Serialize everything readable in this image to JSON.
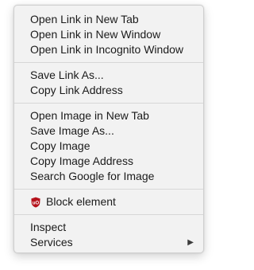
{
  "menu": {
    "group1": [
      {
        "label": "Open Link in New Tab"
      },
      {
        "label": "Open Link in New Window"
      },
      {
        "label": "Open Link in Incognito Window"
      }
    ],
    "group2": [
      {
        "label": "Save Link As..."
      },
      {
        "label": "Copy Link Address"
      }
    ],
    "group3": [
      {
        "label": "Open Image in New Tab"
      },
      {
        "label": "Save Image As..."
      },
      {
        "label": "Copy Image"
      },
      {
        "label": "Copy Image Address"
      },
      {
        "label": "Search Google for Image"
      }
    ],
    "group4": [
      {
        "label": "Block element",
        "icon": "ublock-origin-shield-icon"
      }
    ],
    "group5": [
      {
        "label": "Inspect"
      },
      {
        "label": "Services",
        "submenu_indicator": "▶"
      }
    ]
  },
  "colors": {
    "menu_bg": "#f2f2f2",
    "text": "#1b1b1b",
    "separator": "#d7d7d7",
    "ublock_red": "#b5121b"
  }
}
